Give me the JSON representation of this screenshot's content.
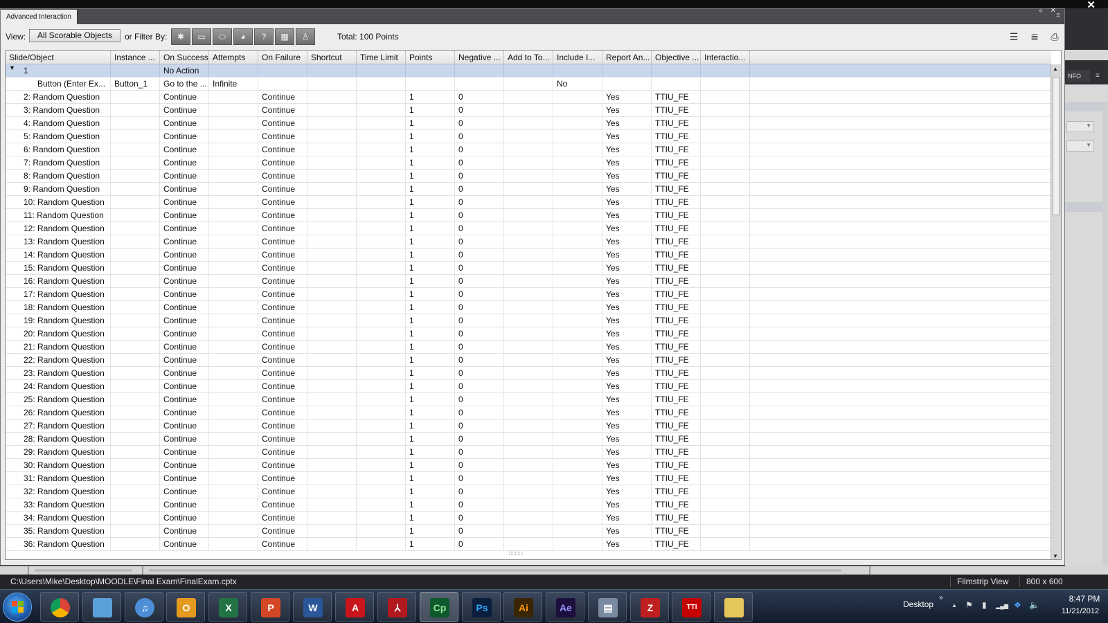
{
  "app": {
    "close_glyph": "✕"
  },
  "dialog": {
    "tab_title": "Advanced Interaction",
    "controls": "« ✕",
    "menu_glyph": "≡"
  },
  "toolbar": {
    "view_label": "View:",
    "view_value": "All Scorable Objects",
    "filter_label": "or Filter By:",
    "filter_buttons": [
      {
        "icon": "click-box-icon",
        "glyph": "✱"
      },
      {
        "icon": "text-entry-icon",
        "glyph": "▭"
      },
      {
        "icon": "button-icon",
        "glyph": "⬭"
      },
      {
        "icon": "rollover-icon",
        "glyph": "◕"
      },
      {
        "icon": "question-icon",
        "glyph": "?"
      },
      {
        "icon": "widget-icon",
        "glyph": "▦"
      },
      {
        "icon": "drag-drop-icon",
        "glyph": "♙"
      }
    ],
    "total": "Total: 100 Points",
    "right_icons": [
      {
        "icon": "collapse-all-icon",
        "glyph": "☰"
      },
      {
        "icon": "expand-all-icon",
        "glyph": "≣"
      },
      {
        "icon": "print-icon",
        "glyph": "⎙"
      }
    ]
  },
  "table": {
    "columns": [
      "Slide/Object",
      "Instance ...",
      "On Success",
      "Attempts",
      "On Failure",
      "Shortcut",
      "Time Limit",
      "Points",
      "Negative ...",
      "Add to To...",
      "Include I...",
      "Report An...",
      "Objective ...",
      "Interactio..."
    ],
    "rows": [
      {
        "type": "group",
        "cells": [
          "1",
          "",
          "No Action",
          "",
          "",
          "",
          "",
          "",
          "",
          "",
          "",
          "",
          "",
          ""
        ]
      },
      {
        "type": "child",
        "cells": [
          "Button (Enter Ex...",
          "Button_1",
          "Go to the ...",
          "Infinite",
          "",
          "",
          "",
          "",
          "",
          "",
          "No",
          "",
          "",
          ""
        ]
      },
      {
        "cells": [
          "2: Random Question",
          "",
          "Continue",
          "",
          "Continue",
          "",
          "",
          "1",
          "0",
          "",
          "",
          "Yes",
          "TTIU_FE",
          ""
        ]
      },
      {
        "cells": [
          "3: Random Question",
          "",
          "Continue",
          "",
          "Continue",
          "",
          "",
          "1",
          "0",
          "",
          "",
          "Yes",
          "TTIU_FE",
          ""
        ]
      },
      {
        "cells": [
          "4: Random Question",
          "",
          "Continue",
          "",
          "Continue",
          "",
          "",
          "1",
          "0",
          "",
          "",
          "Yes",
          "TTIU_FE",
          ""
        ]
      },
      {
        "cells": [
          "5: Random Question",
          "",
          "Continue",
          "",
          "Continue",
          "",
          "",
          "1",
          "0",
          "",
          "",
          "Yes",
          "TTIU_FE",
          ""
        ]
      },
      {
        "cells": [
          "6: Random Question",
          "",
          "Continue",
          "",
          "Continue",
          "",
          "",
          "1",
          "0",
          "",
          "",
          "Yes",
          "TTIU_FE",
          ""
        ]
      },
      {
        "cells": [
          "7: Random Question",
          "",
          "Continue",
          "",
          "Continue",
          "",
          "",
          "1",
          "0",
          "",
          "",
          "Yes",
          "TTIU_FE",
          ""
        ]
      },
      {
        "cells": [
          "8: Random Question",
          "",
          "Continue",
          "",
          "Continue",
          "",
          "",
          "1",
          "0",
          "",
          "",
          "Yes",
          "TTIU_FE",
          ""
        ]
      },
      {
        "cells": [
          "9: Random Question",
          "",
          "Continue",
          "",
          "Continue",
          "",
          "",
          "1",
          "0",
          "",
          "",
          "Yes",
          "TTIU_FE",
          ""
        ]
      },
      {
        "cells": [
          "10: Random Question",
          "",
          "Continue",
          "",
          "Continue",
          "",
          "",
          "1",
          "0",
          "",
          "",
          "Yes",
          "TTIU_FE",
          ""
        ]
      },
      {
        "cells": [
          "11: Random Question",
          "",
          "Continue",
          "",
          "Continue",
          "",
          "",
          "1",
          "0",
          "",
          "",
          "Yes",
          "TTIU_FE",
          ""
        ]
      },
      {
        "cells": [
          "12: Random Question",
          "",
          "Continue",
          "",
          "Continue",
          "",
          "",
          "1",
          "0",
          "",
          "",
          "Yes",
          "TTIU_FE",
          ""
        ]
      },
      {
        "cells": [
          "13: Random Question",
          "",
          "Continue",
          "",
          "Continue",
          "",
          "",
          "1",
          "0",
          "",
          "",
          "Yes",
          "TTIU_FE",
          ""
        ]
      },
      {
        "cells": [
          "14: Random Question",
          "",
          "Continue",
          "",
          "Continue",
          "",
          "",
          "1",
          "0",
          "",
          "",
          "Yes",
          "TTIU_FE",
          ""
        ]
      },
      {
        "cells": [
          "15: Random Question",
          "",
          "Continue",
          "",
          "Continue",
          "",
          "",
          "1",
          "0",
          "",
          "",
          "Yes",
          "TTIU_FE",
          ""
        ]
      },
      {
        "cells": [
          "16: Random Question",
          "",
          "Continue",
          "",
          "Continue",
          "",
          "",
          "1",
          "0",
          "",
          "",
          "Yes",
          "TTIU_FE",
          ""
        ]
      },
      {
        "cells": [
          "17: Random Question",
          "",
          "Continue",
          "",
          "Continue",
          "",
          "",
          "1",
          "0",
          "",
          "",
          "Yes",
          "TTIU_FE",
          ""
        ]
      },
      {
        "cells": [
          "18: Random Question",
          "",
          "Continue",
          "",
          "Continue",
          "",
          "",
          "1",
          "0",
          "",
          "",
          "Yes",
          "TTIU_FE",
          ""
        ]
      },
      {
        "cells": [
          "19: Random Question",
          "",
          "Continue",
          "",
          "Continue",
          "",
          "",
          "1",
          "0",
          "",
          "",
          "Yes",
          "TTIU_FE",
          ""
        ]
      },
      {
        "cells": [
          "20: Random Question",
          "",
          "Continue",
          "",
          "Continue",
          "",
          "",
          "1",
          "0",
          "",
          "",
          "Yes",
          "TTIU_FE",
          ""
        ]
      },
      {
        "cells": [
          "21: Random Question",
          "",
          "Continue",
          "",
          "Continue",
          "",
          "",
          "1",
          "0",
          "",
          "",
          "Yes",
          "TTIU_FE",
          ""
        ]
      },
      {
        "cells": [
          "22: Random Question",
          "",
          "Continue",
          "",
          "Continue",
          "",
          "",
          "1",
          "0",
          "",
          "",
          "Yes",
          "TTIU_FE",
          ""
        ]
      },
      {
        "cells": [
          "23: Random Question",
          "",
          "Continue",
          "",
          "Continue",
          "",
          "",
          "1",
          "0",
          "",
          "",
          "Yes",
          "TTIU_FE",
          ""
        ]
      },
      {
        "cells": [
          "24: Random Question",
          "",
          "Continue",
          "",
          "Continue",
          "",
          "",
          "1",
          "0",
          "",
          "",
          "Yes",
          "TTIU_FE",
          ""
        ]
      },
      {
        "cells": [
          "25: Random Question",
          "",
          "Continue",
          "",
          "Continue",
          "",
          "",
          "1",
          "0",
          "",
          "",
          "Yes",
          "TTIU_FE",
          ""
        ]
      },
      {
        "cells": [
          "26: Random Question",
          "",
          "Continue",
          "",
          "Continue",
          "",
          "",
          "1",
          "0",
          "",
          "",
          "Yes",
          "TTIU_FE",
          ""
        ]
      },
      {
        "cells": [
          "27: Random Question",
          "",
          "Continue",
          "",
          "Continue",
          "",
          "",
          "1",
          "0",
          "",
          "",
          "Yes",
          "TTIU_FE",
          ""
        ]
      },
      {
        "cells": [
          "28: Random Question",
          "",
          "Continue",
          "",
          "Continue",
          "",
          "",
          "1",
          "0",
          "",
          "",
          "Yes",
          "TTIU_FE",
          ""
        ]
      },
      {
        "cells": [
          "29: Random Question",
          "",
          "Continue",
          "",
          "Continue",
          "",
          "",
          "1",
          "0",
          "",
          "",
          "Yes",
          "TTIU_FE",
          ""
        ]
      },
      {
        "cells": [
          "30: Random Question",
          "",
          "Continue",
          "",
          "Continue",
          "",
          "",
          "1",
          "0",
          "",
          "",
          "Yes",
          "TTIU_FE",
          ""
        ]
      },
      {
        "cells": [
          "31: Random Question",
          "",
          "Continue",
          "",
          "Continue",
          "",
          "",
          "1",
          "0",
          "",
          "",
          "Yes",
          "TTIU_FE",
          ""
        ]
      },
      {
        "cells": [
          "32: Random Question",
          "",
          "Continue",
          "",
          "Continue",
          "",
          "",
          "1",
          "0",
          "",
          "",
          "Yes",
          "TTIU_FE",
          ""
        ]
      },
      {
        "cells": [
          "33: Random Question",
          "",
          "Continue",
          "",
          "Continue",
          "",
          "",
          "1",
          "0",
          "",
          "",
          "Yes",
          "TTIU_FE",
          ""
        ]
      },
      {
        "cells": [
          "34: Random Question",
          "",
          "Continue",
          "",
          "Continue",
          "",
          "",
          "1",
          "0",
          "",
          "",
          "Yes",
          "TTIU_FE",
          ""
        ]
      },
      {
        "cells": [
          "35: Random Question",
          "",
          "Continue",
          "",
          "Continue",
          "",
          "",
          "1",
          "0",
          "",
          "",
          "Yes",
          "TTIU_FE",
          ""
        ]
      },
      {
        "cells": [
          "36: Random Question",
          "",
          "Continue",
          "",
          "Continue",
          "",
          "",
          "1",
          "0",
          "",
          "",
          "Yes",
          "TTIU_FE",
          ""
        ]
      }
    ]
  },
  "background_panel": {
    "tab_label": "NFO",
    "menu_glyph": "≡"
  },
  "status": {
    "file_path": "C:\\Users\\Mike\\Desktop\\MOODLE\\Final Exam\\FinalExam.cptx",
    "view_mode": "Filmstrip View",
    "resolution": "800 x 600"
  },
  "taskbar": {
    "apps": [
      {
        "icon": "chrome-icon",
        "label": "",
        "color": "#2e9e44"
      },
      {
        "icon": "network-people-icon",
        "label": "",
        "color": "#5aa0d8"
      },
      {
        "icon": "itunes-icon",
        "label": "♫",
        "color": "#4d8fd6"
      },
      {
        "icon": "outlook-icon",
        "label": "O",
        "color": "#e39a1f"
      },
      {
        "icon": "excel-icon",
        "label": "X",
        "color": "#217346"
      },
      {
        "icon": "powerpoint-icon",
        "label": "P",
        "color": "#d24726"
      },
      {
        "icon": "word-icon",
        "label": "W",
        "color": "#2b579a"
      },
      {
        "icon": "acrobat-icon",
        "label": "A",
        "color": "#c8151b"
      },
      {
        "icon": "acrobat-reader-icon",
        "label": "⅄",
        "color": "#b1191f"
      },
      {
        "icon": "captivate-icon",
        "label": "Cp",
        "color": "#0c5a2e"
      },
      {
        "icon": "photoshop-icon",
        "label": "Ps",
        "color": "#0a1f3d"
      },
      {
        "icon": "illustrator-icon",
        "label": "Ai",
        "color": "#3a2505"
      },
      {
        "icon": "after-effects-icon",
        "label": "Ae",
        "color": "#1c0f3d"
      },
      {
        "icon": "scanner-icon",
        "label": "▤",
        "color": "#7a8aa0"
      },
      {
        "icon": "filezilla-icon",
        "label": "Z",
        "color": "#bf1f1f"
      },
      {
        "icon": "ttiu-icon",
        "label": "TTI",
        "color": "#c40000"
      },
      {
        "icon": "folder-icon",
        "label": "",
        "color": "#e5c65a"
      }
    ],
    "desktop_label": "Desktop",
    "desktop_chevron": "»",
    "tray_icons": [
      {
        "icon": "show-hidden-icon",
        "glyph": "▲"
      },
      {
        "icon": "action-center-flag-icon",
        "glyph": "⚑"
      },
      {
        "icon": "battery-icon",
        "glyph": "▮"
      },
      {
        "icon": "network-signal-icon",
        "glyph": "▂▄▆"
      },
      {
        "icon": "dropbox-icon",
        "glyph": "❖"
      },
      {
        "icon": "volume-icon",
        "glyph": "🔈"
      }
    ],
    "time": "8:47 PM",
    "date": "11/21/2012"
  }
}
